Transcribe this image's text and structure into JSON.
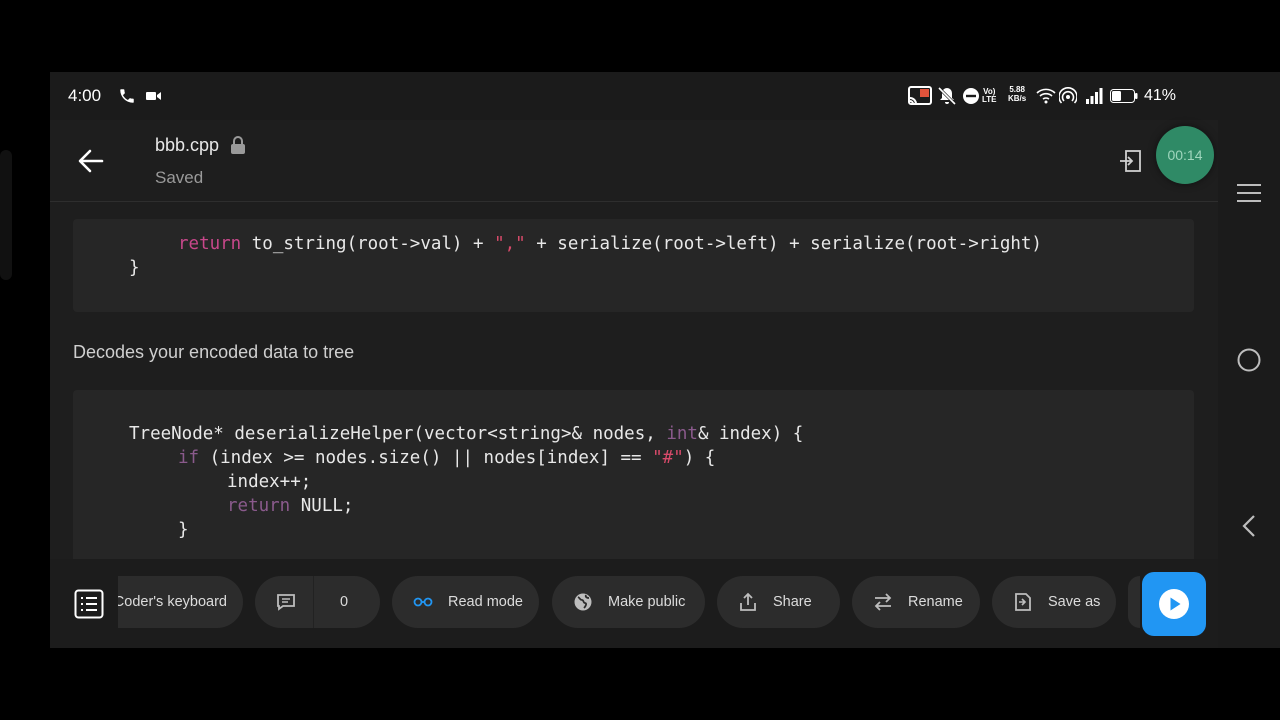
{
  "status_bar": {
    "time": "4:00",
    "network_speed_value": "5.88",
    "network_speed_unit": "KB/s",
    "battery": "41%"
  },
  "header": {
    "file_name": "bbb.cpp",
    "save_status": "Saved",
    "timer": "00:14"
  },
  "content": {
    "code_block_1": {
      "line1": {
        "kw": "return",
        "t1": " to_string(root->val) + ",
        "str": "\",\"",
        "t2": " + serialize(root->left) + serialize(root->right)"
      },
      "line2": "}"
    },
    "description": "Decodes your encoded data to tree",
    "code_block_2": {
      "line1": {
        "t1": "TreeNode* deserializeHelper(vector<string>& nodes, ",
        "ty": "int",
        "t2": "& index) {"
      },
      "line2": {
        "kw": "if",
        "t1": " (index >= nodes.size() || nodes[index] == ",
        "str": "\"#\"",
        "t2": ") {"
      },
      "line3": "index++;",
      "line4": {
        "kw": "return",
        "t1": " NULL;"
      },
      "line5": "}"
    }
  },
  "toolbar": {
    "keyboard_label": "Coder's keyboard",
    "comments_count": "0",
    "read_mode_label": "Read mode",
    "make_public_label": "Make public",
    "share_label": "Share",
    "rename_label": "Rename",
    "save_as_label": "Save as"
  },
  "colors": {
    "accent_blue": "#2196f3",
    "timer_green": "#2f8a66",
    "keyword_pink": "#c7478a",
    "string_red": "#d84a6a",
    "background": "#1e1e1e"
  }
}
